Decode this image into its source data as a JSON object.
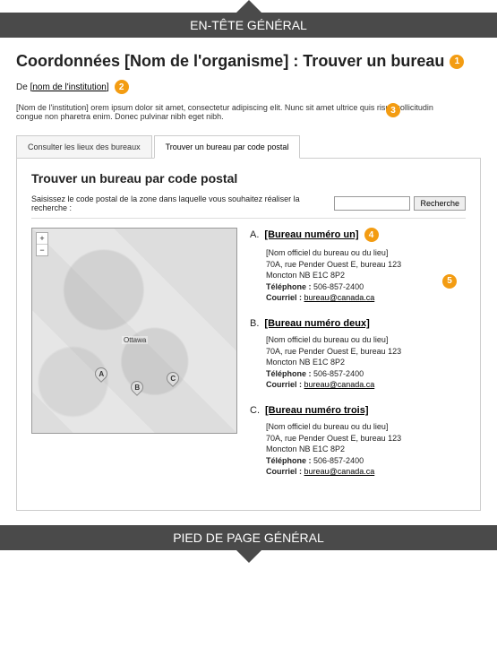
{
  "header": {
    "label": "EN-TÊTE GÉNÉRAL"
  },
  "footer": {
    "label": "PIED DE PAGE GÉNÉRAL"
  },
  "title": "Coordonnées [Nom de l'organisme] : Trouver un bureau",
  "byline_prefix": "De ",
  "byline_link": "[nom de l'institution]",
  "intro": "[Nom de l'institution] orem ipsum dolor sit amet, consectetur adipiscing elit. Nunc sit amet ultrice quis risus sollicitudin congue non pharetra enim. Donec pulvinar nibh eget nibh.",
  "tabs": [
    {
      "label": "Consulter les lieux des bureaux",
      "active": false
    },
    {
      "label": "Trouver un bureau par code postal",
      "active": true
    }
  ],
  "panel": {
    "heading": "Trouver un bureau par code postal",
    "search_label": "Saisissez le code postal de la zone dans laquelle vous souhaitez réaliser la recherche :",
    "search_button": "Recherche",
    "search_value": ""
  },
  "map": {
    "center_label": "Ottawa",
    "pins": [
      "A",
      "B",
      "C"
    ]
  },
  "offices": [
    {
      "letter": "A.",
      "link": "[Bureau numéro un]",
      "name": "[Nom officiel du bureau ou du lieu]",
      "address": "70A, rue Pender Ouest E, bureau 123",
      "city": "Moncton NB  E1C 8P2",
      "phone_label": "Téléphone :",
      "phone": "506-857-2400",
      "email_label": "Courriel :",
      "email": "bureau@canada.ca",
      "badge_head": "4",
      "badge_body": "5"
    },
    {
      "letter": "B.",
      "link": "[Bureau numéro deux]",
      "name": "[Nom officiel du bureau ou du lieu]",
      "address": "70A, rue Pender Ouest E, bureau 123",
      "city": "Moncton NB  E1C 8P2",
      "phone_label": "Téléphone :",
      "phone": "506-857-2400",
      "email_label": "Courriel :",
      "email": "bureau@canada.ca"
    },
    {
      "letter": "C.",
      "link": "[Bureau numéro trois]",
      "name": "[Nom officiel du bureau ou du lieu]",
      "address": "70A, rue Pender Ouest E, bureau 123",
      "city": "Moncton NB  E1C 8P2",
      "phone_label": "Téléphone :",
      "phone": "506-857-2400",
      "email_label": "Courriel :",
      "email": "bureau@canada.ca"
    }
  ],
  "badges": {
    "b1": "1",
    "b2": "2",
    "b3": "3"
  }
}
